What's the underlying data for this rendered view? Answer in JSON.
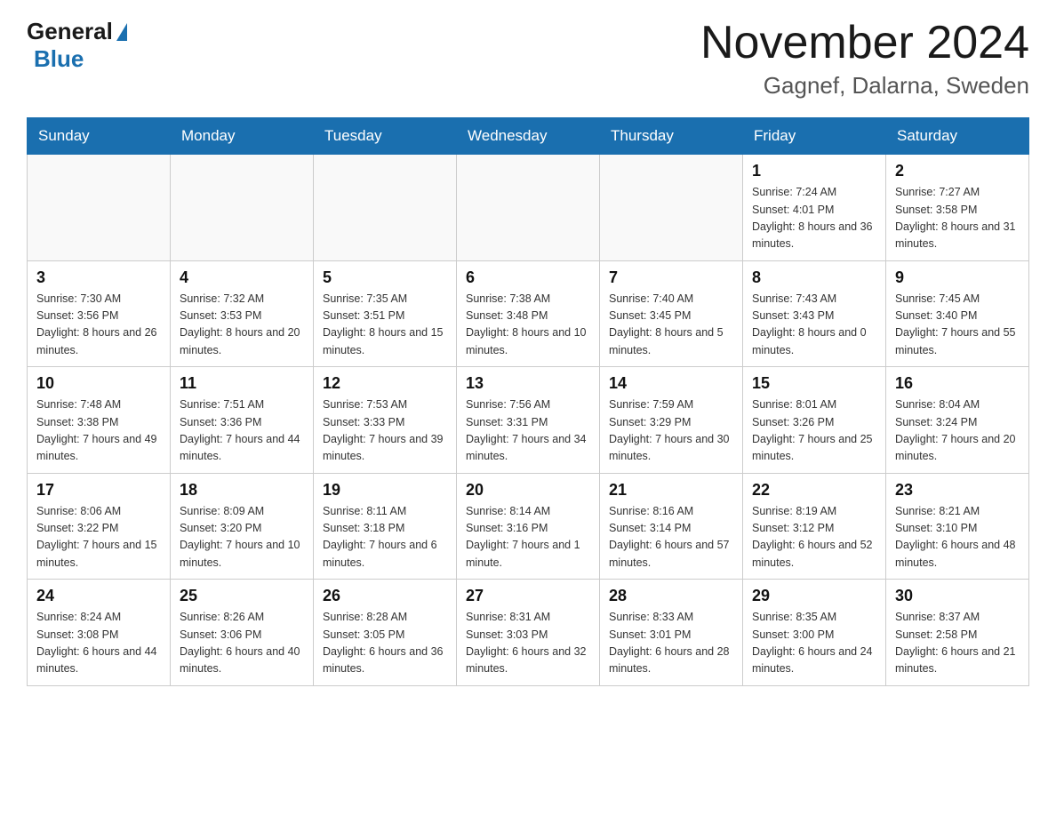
{
  "header": {
    "logo_general": "General",
    "logo_blue": "Blue",
    "month_title": "November 2024",
    "location": "Gagnef, Dalarna, Sweden"
  },
  "days_of_week": [
    "Sunday",
    "Monday",
    "Tuesday",
    "Wednesday",
    "Thursday",
    "Friday",
    "Saturday"
  ],
  "weeks": [
    [
      {
        "day": "",
        "info": ""
      },
      {
        "day": "",
        "info": ""
      },
      {
        "day": "",
        "info": ""
      },
      {
        "day": "",
        "info": ""
      },
      {
        "day": "",
        "info": ""
      },
      {
        "day": "1",
        "info": "Sunrise: 7:24 AM\nSunset: 4:01 PM\nDaylight: 8 hours\nand 36 minutes."
      },
      {
        "day": "2",
        "info": "Sunrise: 7:27 AM\nSunset: 3:58 PM\nDaylight: 8 hours\nand 31 minutes."
      }
    ],
    [
      {
        "day": "3",
        "info": "Sunrise: 7:30 AM\nSunset: 3:56 PM\nDaylight: 8 hours\nand 26 minutes."
      },
      {
        "day": "4",
        "info": "Sunrise: 7:32 AM\nSunset: 3:53 PM\nDaylight: 8 hours\nand 20 minutes."
      },
      {
        "day": "5",
        "info": "Sunrise: 7:35 AM\nSunset: 3:51 PM\nDaylight: 8 hours\nand 15 minutes."
      },
      {
        "day": "6",
        "info": "Sunrise: 7:38 AM\nSunset: 3:48 PM\nDaylight: 8 hours\nand 10 minutes."
      },
      {
        "day": "7",
        "info": "Sunrise: 7:40 AM\nSunset: 3:45 PM\nDaylight: 8 hours\nand 5 minutes."
      },
      {
        "day": "8",
        "info": "Sunrise: 7:43 AM\nSunset: 3:43 PM\nDaylight: 8 hours\nand 0 minutes."
      },
      {
        "day": "9",
        "info": "Sunrise: 7:45 AM\nSunset: 3:40 PM\nDaylight: 7 hours\nand 55 minutes."
      }
    ],
    [
      {
        "day": "10",
        "info": "Sunrise: 7:48 AM\nSunset: 3:38 PM\nDaylight: 7 hours\nand 49 minutes."
      },
      {
        "day": "11",
        "info": "Sunrise: 7:51 AM\nSunset: 3:36 PM\nDaylight: 7 hours\nand 44 minutes."
      },
      {
        "day": "12",
        "info": "Sunrise: 7:53 AM\nSunset: 3:33 PM\nDaylight: 7 hours\nand 39 minutes."
      },
      {
        "day": "13",
        "info": "Sunrise: 7:56 AM\nSunset: 3:31 PM\nDaylight: 7 hours\nand 34 minutes."
      },
      {
        "day": "14",
        "info": "Sunrise: 7:59 AM\nSunset: 3:29 PM\nDaylight: 7 hours\nand 30 minutes."
      },
      {
        "day": "15",
        "info": "Sunrise: 8:01 AM\nSunset: 3:26 PM\nDaylight: 7 hours\nand 25 minutes."
      },
      {
        "day": "16",
        "info": "Sunrise: 8:04 AM\nSunset: 3:24 PM\nDaylight: 7 hours\nand 20 minutes."
      }
    ],
    [
      {
        "day": "17",
        "info": "Sunrise: 8:06 AM\nSunset: 3:22 PM\nDaylight: 7 hours\nand 15 minutes."
      },
      {
        "day": "18",
        "info": "Sunrise: 8:09 AM\nSunset: 3:20 PM\nDaylight: 7 hours\nand 10 minutes."
      },
      {
        "day": "19",
        "info": "Sunrise: 8:11 AM\nSunset: 3:18 PM\nDaylight: 7 hours\nand 6 minutes."
      },
      {
        "day": "20",
        "info": "Sunrise: 8:14 AM\nSunset: 3:16 PM\nDaylight: 7 hours\nand 1 minute."
      },
      {
        "day": "21",
        "info": "Sunrise: 8:16 AM\nSunset: 3:14 PM\nDaylight: 6 hours\nand 57 minutes."
      },
      {
        "day": "22",
        "info": "Sunrise: 8:19 AM\nSunset: 3:12 PM\nDaylight: 6 hours\nand 52 minutes."
      },
      {
        "day": "23",
        "info": "Sunrise: 8:21 AM\nSunset: 3:10 PM\nDaylight: 6 hours\nand 48 minutes."
      }
    ],
    [
      {
        "day": "24",
        "info": "Sunrise: 8:24 AM\nSunset: 3:08 PM\nDaylight: 6 hours\nand 44 minutes."
      },
      {
        "day": "25",
        "info": "Sunrise: 8:26 AM\nSunset: 3:06 PM\nDaylight: 6 hours\nand 40 minutes."
      },
      {
        "day": "26",
        "info": "Sunrise: 8:28 AM\nSunset: 3:05 PM\nDaylight: 6 hours\nand 36 minutes."
      },
      {
        "day": "27",
        "info": "Sunrise: 8:31 AM\nSunset: 3:03 PM\nDaylight: 6 hours\nand 32 minutes."
      },
      {
        "day": "28",
        "info": "Sunrise: 8:33 AM\nSunset: 3:01 PM\nDaylight: 6 hours\nand 28 minutes."
      },
      {
        "day": "29",
        "info": "Sunrise: 8:35 AM\nSunset: 3:00 PM\nDaylight: 6 hours\nand 24 minutes."
      },
      {
        "day": "30",
        "info": "Sunrise: 8:37 AM\nSunset: 2:58 PM\nDaylight: 6 hours\nand 21 minutes."
      }
    ]
  ]
}
